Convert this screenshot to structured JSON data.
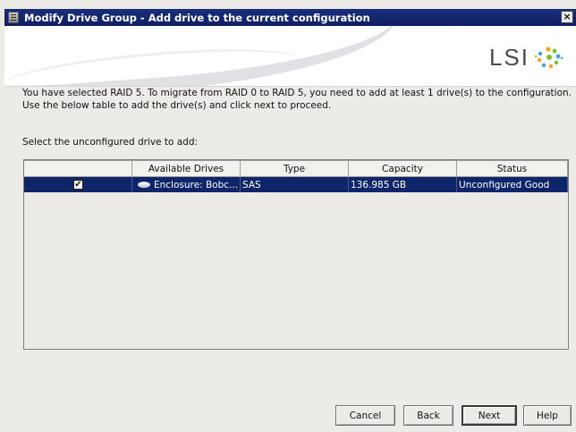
{
  "window": {
    "title": "Modify Drive Group - Add drive to the current configuration",
    "close_glyph": "×"
  },
  "banner": {
    "logo_text": "LSI"
  },
  "content": {
    "description_line1": "You have selected RAID 5. To migrate from RAID 0 to RAID 5, you need to add at least 1 drive(s) to the configuration.",
    "description_line2": "Use the below table to add the drive(s) and click next to proceed.",
    "prompt": "Select the unconfigured drive to add:"
  },
  "table": {
    "columns": [
      "",
      "Available Drives",
      "Type",
      "Capacity",
      "Status"
    ],
    "rows": [
      {
        "checked": true,
        "check_glyph": "✔",
        "available_drive": "Enclosure: Bobc...",
        "type": "SAS",
        "capacity": "136.985 GB",
        "status": "Unconfigured Good"
      }
    ]
  },
  "buttons": {
    "cancel": "Cancel",
    "back": "Back",
    "next": "Next",
    "help": "Help"
  },
  "colors": {
    "title_bar": "#1a2e7a",
    "selection": "#0e2569",
    "dialog_bg": "#ecebe8"
  }
}
